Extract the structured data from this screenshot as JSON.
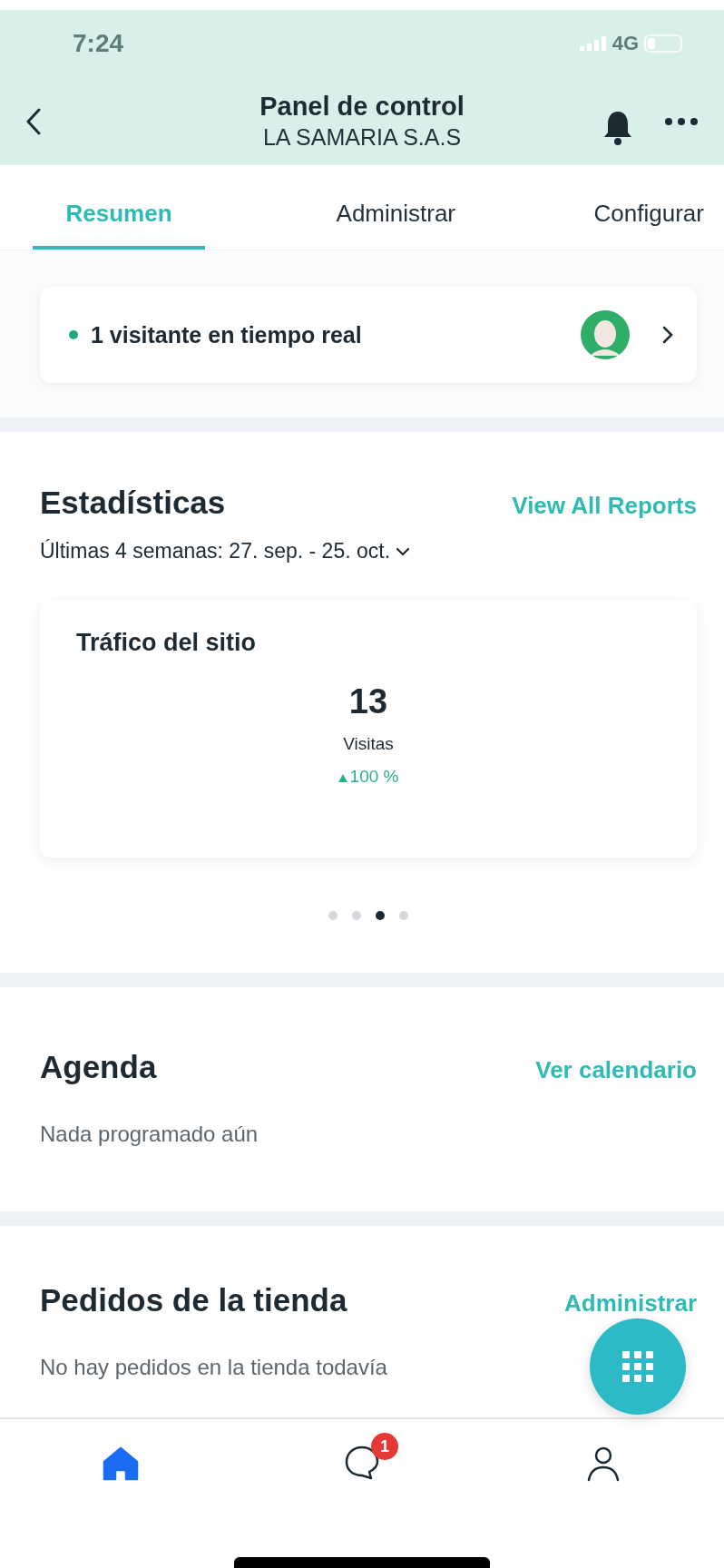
{
  "status_bar": {
    "time": "7:24",
    "network": "4G"
  },
  "header": {
    "title": "Panel de control",
    "subtitle": "LA SAMARIA S.A.S"
  },
  "tabs": [
    {
      "label": "Resumen",
      "selected": true
    },
    {
      "label": "Administrar",
      "selected": false
    },
    {
      "label": "Configurar",
      "selected": false
    }
  ],
  "live_visitors": {
    "text": "1 visitante en tiempo real"
  },
  "statistics": {
    "title": "Estadísticas",
    "link": "View All Reports",
    "period": "Últimas 4 semanas: 27. sep. - 25. oct.",
    "card": {
      "title": "Tráfico del sitio",
      "value": "13",
      "label": "Visitas",
      "change": "100 %"
    },
    "pages": [
      {
        "selected": false
      },
      {
        "selected": false
      },
      {
        "selected": true
      },
      {
        "selected": false
      }
    ]
  },
  "agenda": {
    "title": "Agenda",
    "link": "Ver calendario",
    "empty": "Nada programado aún"
  },
  "orders": {
    "title": "Pedidos de la tienda",
    "link": "Administrar",
    "empty": "No hay pedidos en la tienda todavía"
  },
  "bottom_nav": [
    {
      "kind": "home",
      "selected": true
    },
    {
      "kind": "chat",
      "selected": false,
      "badge": "1"
    },
    {
      "kind": "profile",
      "selected": false
    }
  ]
}
